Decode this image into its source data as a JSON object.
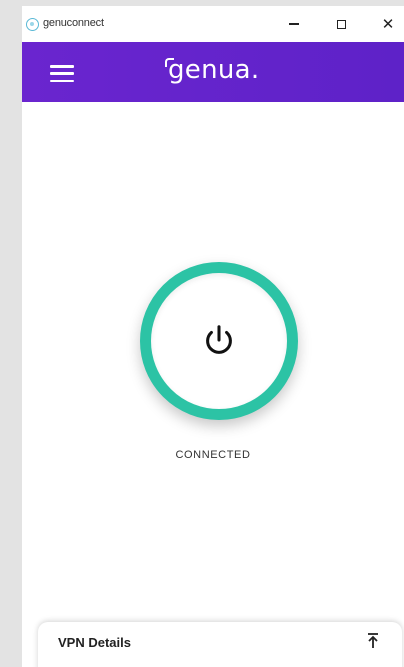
{
  "window": {
    "title": "genuconnect",
    "logo_icon": "genuconnect-logo-icon",
    "controls": [
      "minimize-icon",
      "maximize-icon",
      "close-icon"
    ]
  },
  "appbar": {
    "brand": "genua.",
    "menu_icon": "hamburger-menu-icon",
    "color": "#6124cc"
  },
  "connection": {
    "status": "CONNECTED",
    "button_icon": "power-icon",
    "ring_color": "#2cc3a5"
  },
  "details": {
    "title": "VPN Details",
    "expand_icon": "expand-up-icon"
  }
}
